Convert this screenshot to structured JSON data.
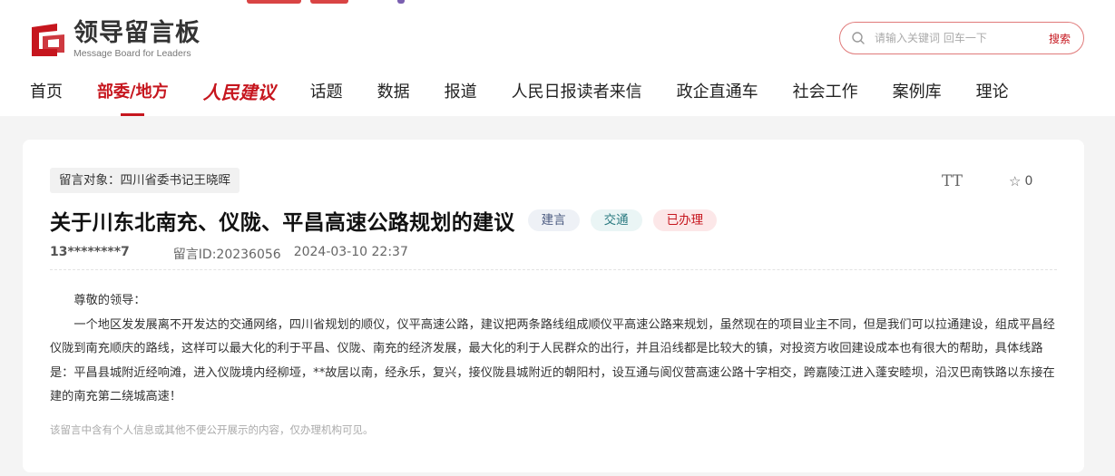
{
  "brand": {
    "name_cn": "领导留言板",
    "name_en": "Message Board for Leaders"
  },
  "search": {
    "placeholder": "请输入关键词 回车一下",
    "button": "搜索"
  },
  "nav": {
    "items": [
      {
        "label": "首页"
      },
      {
        "label": "部委/地方",
        "active": true
      },
      {
        "label": "人民建议",
        "brand": true
      },
      {
        "label": "话题"
      },
      {
        "label": "数据"
      },
      {
        "label": "报道"
      },
      {
        "label": "人民日报读者来信"
      },
      {
        "label": "政企直通车"
      },
      {
        "label": "社会工作"
      },
      {
        "label": "案例库"
      },
      {
        "label": "理论"
      }
    ]
  },
  "message": {
    "target": "留言对象：四川省委书记王晓晖",
    "title": "关于川东北南充、仪陇、平昌高速公路规划的建议",
    "tags": [
      "建言",
      "交通",
      "已办理"
    ],
    "author": "13********7",
    "id_text": "留言ID:20236056",
    "datetime": "2024-03-10 22:37",
    "favorite_count": "0",
    "font_toggle": "TT",
    "greeting": "尊敬的领导：",
    "body": "一个地区发发展离不开发达的交通网络，四川省规划的顺仪，仪平高速公路，建议把两条路线组成顺仪平高速公路来规划，虽然现在的项目业主不同，但是我们可以拉通建设，组成平昌经仪陇到南充顺庆的路线，这样可以最大化的利于平昌、仪陇、南充的经济发展，最大化的利于人民群众的出行，并且沿线都是比较大的镇，对投资方收回建设成本也有很大的帮助，具体线路是：平昌县城附近经响滩，进入仪陇境内经柳垭，**故居以南，经永乐，复兴，接仪陇县城附近的朝阳村，设互通与阆仪营高速公路十字相交，跨嘉陵江进入蓬安睦坝，沿汉巴南铁路以东接在建的南充第二绕城高速！",
    "privacy_note": "该留言中含有个人信息或其他不便公开展示的内容，仅办理机构可见。"
  },
  "colors": {
    "accent": "#c6161e",
    "page_bg": "#f4f4f4"
  }
}
